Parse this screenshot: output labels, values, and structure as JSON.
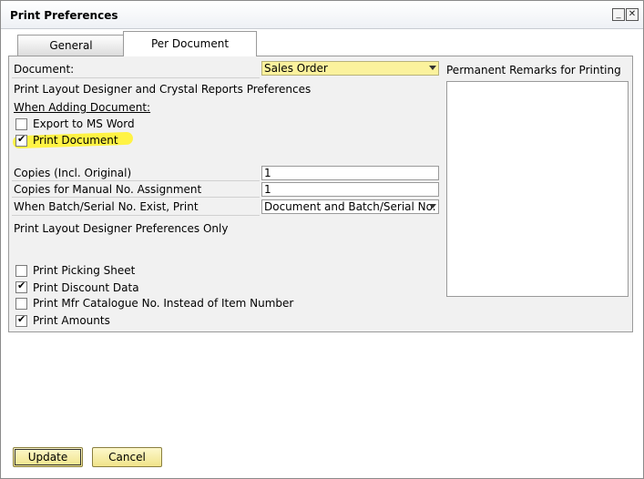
{
  "window": {
    "title": "Print Preferences"
  },
  "tabs": [
    {
      "label": "General"
    },
    {
      "label": "Per Document"
    }
  ],
  "document": {
    "label": "Document:",
    "value": "Sales Order"
  },
  "remarks": {
    "label": "Permanent Remarks for Printing"
  },
  "sections": {
    "pld_crystal": "Print Layout Designer and Crystal Reports Preferences",
    "when_adding": "When Adding Document:",
    "pld_only": "Print Layout Designer Preferences Only"
  },
  "checkboxes": {
    "export_word": {
      "label": "Export to MS Word",
      "checked": false
    },
    "print_document": {
      "label": "Print Document",
      "checked": true
    },
    "print_picking": {
      "label": "Print Picking Sheet",
      "checked": false
    },
    "print_discount": {
      "label": "Print Discount Data",
      "checked": true
    },
    "print_mfr": {
      "label": "Print Mfr Catalogue No. Instead of Item Number",
      "checked": false
    },
    "print_amounts": {
      "label": "Print Amounts",
      "checked": true
    }
  },
  "fields": {
    "copies": {
      "label": "Copies (Incl. Original)",
      "value": "1"
    },
    "copies_manual": {
      "label": "Copies for Manual No. Assignment",
      "value": "1"
    },
    "batch_serial": {
      "label": "When Batch/Serial No. Exist, Print",
      "value": "Document and Batch/Serial No."
    }
  },
  "buttons": {
    "update": "Update",
    "cancel": "Cancel"
  },
  "glyphs": {
    "check": "✔",
    "minimize": "_",
    "close": "✕"
  },
  "colors": {
    "highlight": "#fff23a",
    "field_yellow": "#fbf29d",
    "button": "#f0e389"
  }
}
